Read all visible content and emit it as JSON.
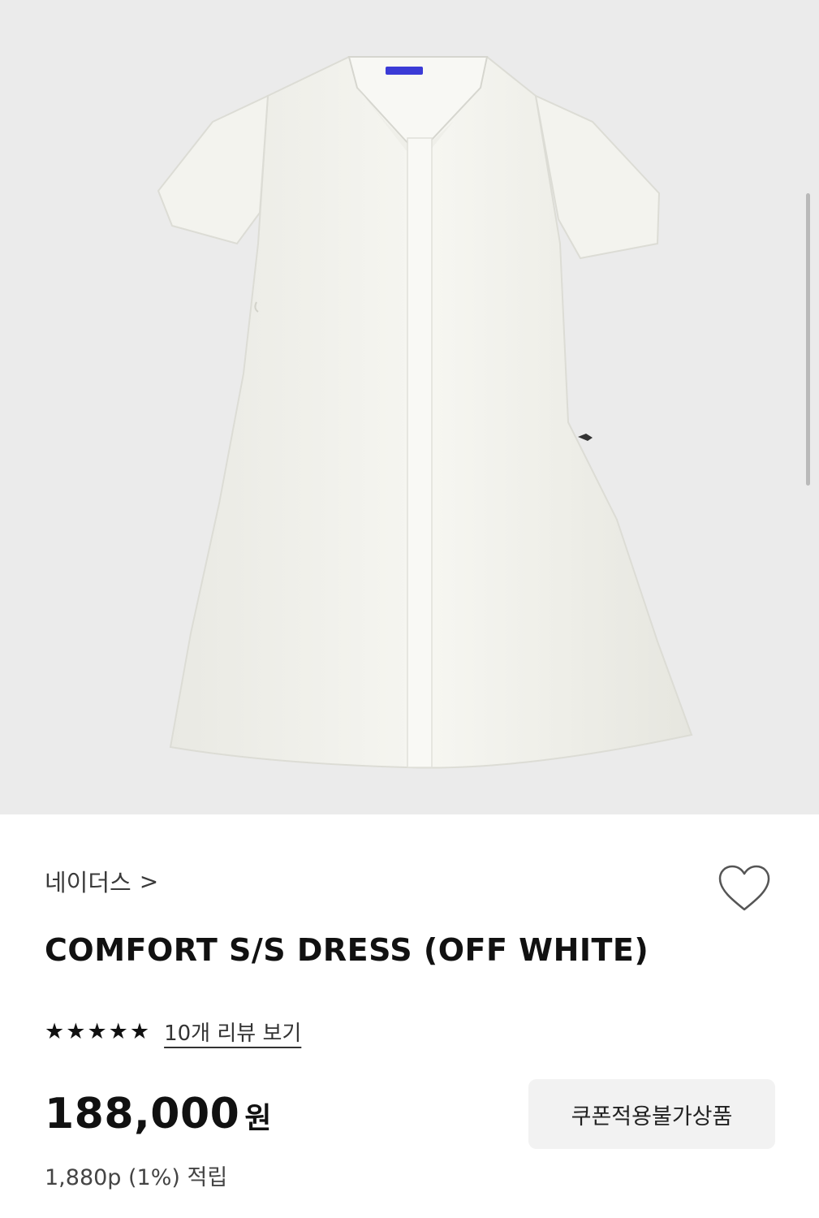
{
  "product": {
    "image_alt": "COMFORT S/S DRESS (OFF WHITE) product photo",
    "brand": "네이더스",
    "brand_chevron": ">",
    "title": "COMFORT S/S DRESS (OFF WHITE)",
    "rating": {
      "stars": 5,
      "star_glyph": "★",
      "review_link": "10개 리뷰 보기"
    },
    "price": {
      "amount": "188,000",
      "currency": "원"
    },
    "coupon_badge": "쿠폰적용불가상품",
    "points": "1,880p (1%) 적립",
    "wishlist_icon": "heart-outline-icon"
  },
  "colors": {
    "photo_background": "#ebebeb",
    "text_primary": "#111111",
    "badge_background": "#f2f2f2",
    "label_accent": "#3b3bd6"
  }
}
